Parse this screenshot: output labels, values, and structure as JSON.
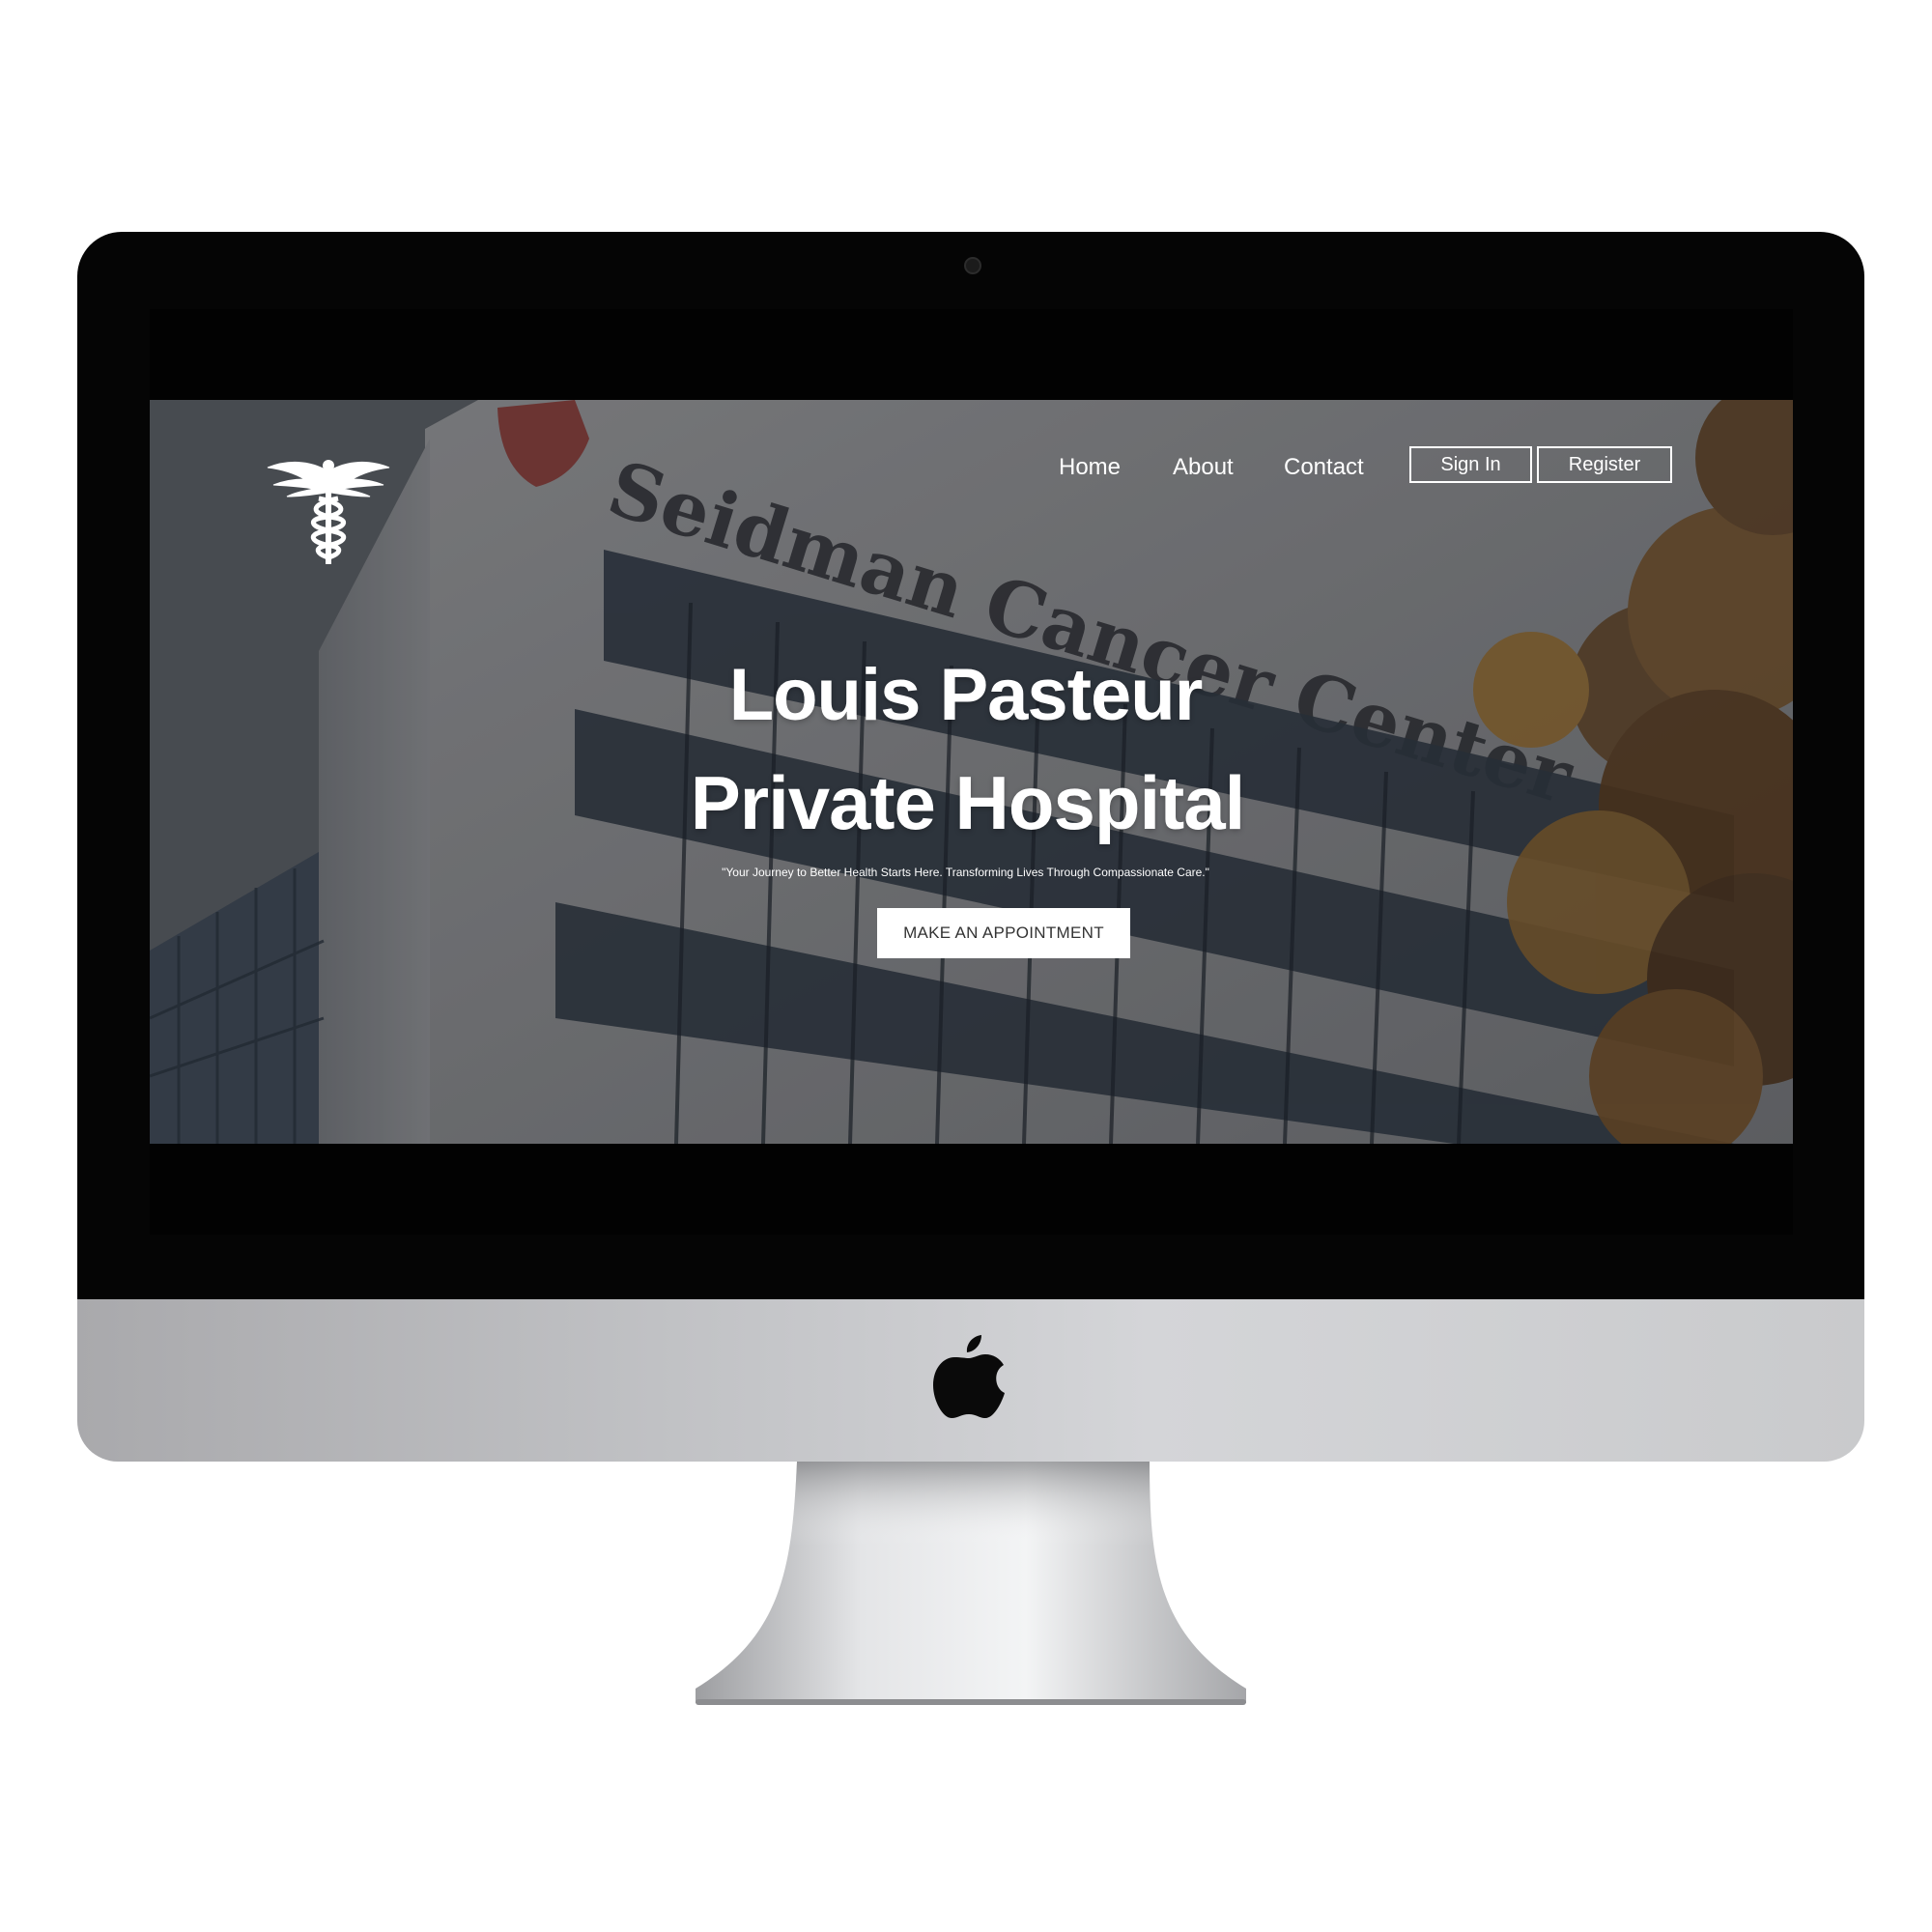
{
  "device": {
    "frame": "iMac",
    "logo_icon": "apple-icon",
    "bezel_color": "#050505",
    "chin_color": "#c2c3c6"
  },
  "site": {
    "logo_icon": "caduceus-icon",
    "nav": {
      "home": "Home",
      "about": "About",
      "contact": "Contact",
      "sign_in": "Sign In",
      "register": "Register"
    },
    "hero": {
      "title_line1": "Louis Pasteur",
      "title_line2": "Private Hospital",
      "tagline": "\"Your Journey to Better Health Starts Here. Transforming Lives Through Compassionate Care.\"",
      "cta_label": "MAKE AN APPOINTMENT",
      "background_image": "hospital-building-photo",
      "building_sign_text": "Seidman Cancer Center"
    }
  }
}
